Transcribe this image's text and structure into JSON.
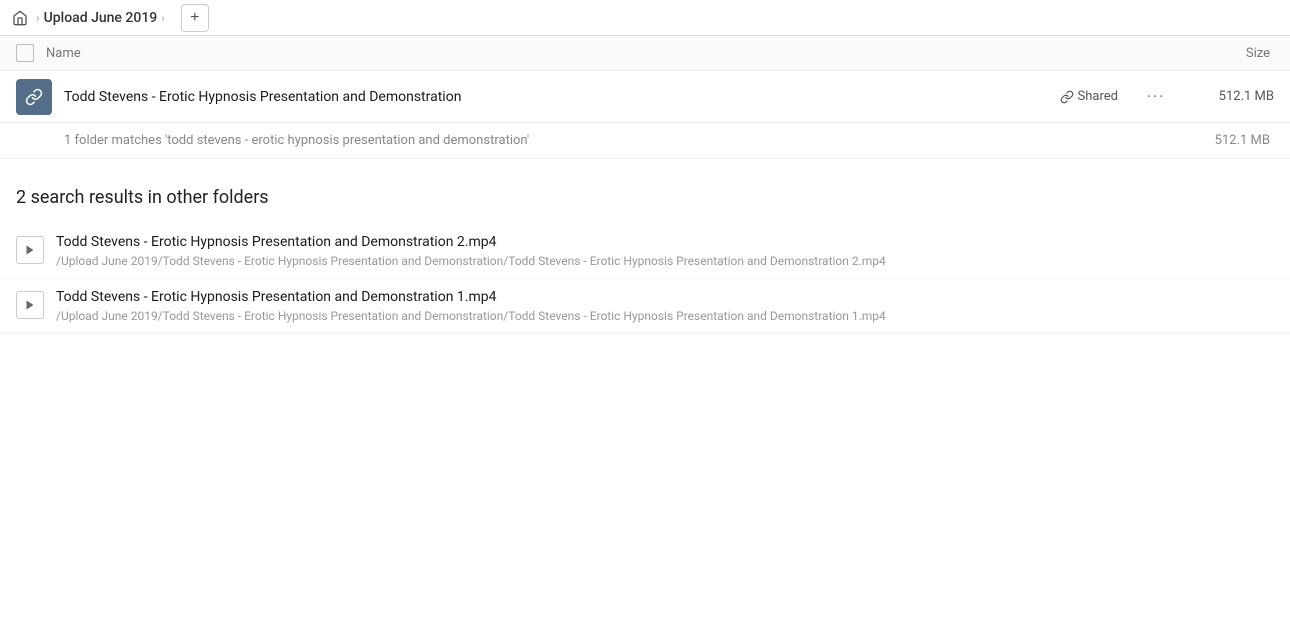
{
  "topbar": {
    "home_label": "Home",
    "breadcrumb": "Upload June 2019",
    "add_label": "+"
  },
  "columns": {
    "name_label": "Name",
    "size_label": "Size"
  },
  "folder": {
    "name": "Todd Stevens - Erotic Hypnosis Presentation and Demonstration",
    "shared_label": "Shared",
    "size": "512.1 MB",
    "more_label": "···"
  },
  "match_summary": {
    "text": "1 folder matches 'todd stevens - erotic hypnosis presentation and demonstration'",
    "size": "512.1 MB"
  },
  "other_folders": {
    "heading": "2 search results in other folders",
    "items": [
      {
        "name": "Todd Stevens - Erotic Hypnosis Presentation and Demonstration 2.mp4",
        "path": "/Upload June 2019/Todd Stevens - Erotic Hypnosis Presentation and Demonstration/Todd Stevens - Erotic Hypnosis Presentation and Demonstration 2.mp4"
      },
      {
        "name": "Todd Stevens - Erotic Hypnosis Presentation and Demonstration 1.mp4",
        "path": "/Upload June 2019/Todd Stevens - Erotic Hypnosis Presentation and Demonstration/Todd Stevens - Erotic Hypnosis Presentation and Demonstration 1.mp4"
      }
    ]
  }
}
